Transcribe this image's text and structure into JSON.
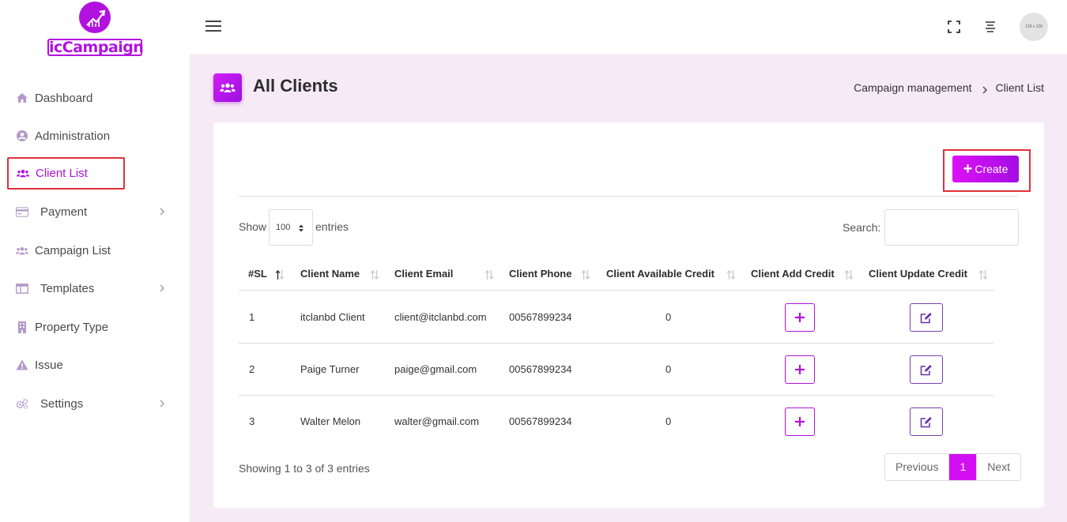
{
  "brand": {
    "logo_text": "icCampaign"
  },
  "sidebar": {
    "items": [
      {
        "label": "Dashboard",
        "icon": "home-icon"
      },
      {
        "label": "Administration",
        "icon": "user-circle-icon"
      },
      {
        "label": "Client List",
        "icon": "users-icon",
        "active": true
      },
      {
        "label": "Payment",
        "icon": "credit-card-icon",
        "has_submenu": true
      },
      {
        "label": "Campaign List",
        "icon": "users-icon"
      },
      {
        "label": "Templates",
        "icon": "columns-icon",
        "has_submenu": true
      },
      {
        "label": "Property Type",
        "icon": "building-icon"
      },
      {
        "label": "Issue",
        "icon": "warning-icon"
      },
      {
        "label": "Settings",
        "icon": "cogs-icon",
        "has_submenu": true
      }
    ]
  },
  "topbar": {
    "avatar_text": "128 x 128"
  },
  "page": {
    "title": "All Clients",
    "breadcrumb": [
      "Campaign management",
      "Client List"
    ]
  },
  "toolbar": {
    "create_label": "Create"
  },
  "table_controls": {
    "show_label": "Show",
    "page_size": "100",
    "entries_label": "entries",
    "search_label": "Search:",
    "search_value": ""
  },
  "table": {
    "columns": [
      "#SL",
      "Client Name",
      "Client Email",
      "Client Phone",
      "Client Available Credit",
      "Client Add Credit",
      "Client Update Credit"
    ],
    "rows": [
      {
        "sl": "1",
        "name": "itclanbd Client",
        "email": "client@itclanbd.com",
        "phone": "00567899234",
        "credit": "0"
      },
      {
        "sl": "2",
        "name": "Paige Turner",
        "email": "paige@gmail.com",
        "phone": "00567899234",
        "credit": "0"
      },
      {
        "sl": "3",
        "name": "Walter Melon",
        "email": "walter@gmail.com",
        "phone": "00567899234",
        "credit": "0"
      }
    ]
  },
  "footer": {
    "showing": "Showing 1 to 3 of 3 entries",
    "pagination": {
      "previous": "Previous",
      "current": "1",
      "next": "Next"
    }
  },
  "colors": {
    "accent": "#b211e0",
    "highlight": "#e0323b",
    "page_bg": "#f5eaf5"
  }
}
